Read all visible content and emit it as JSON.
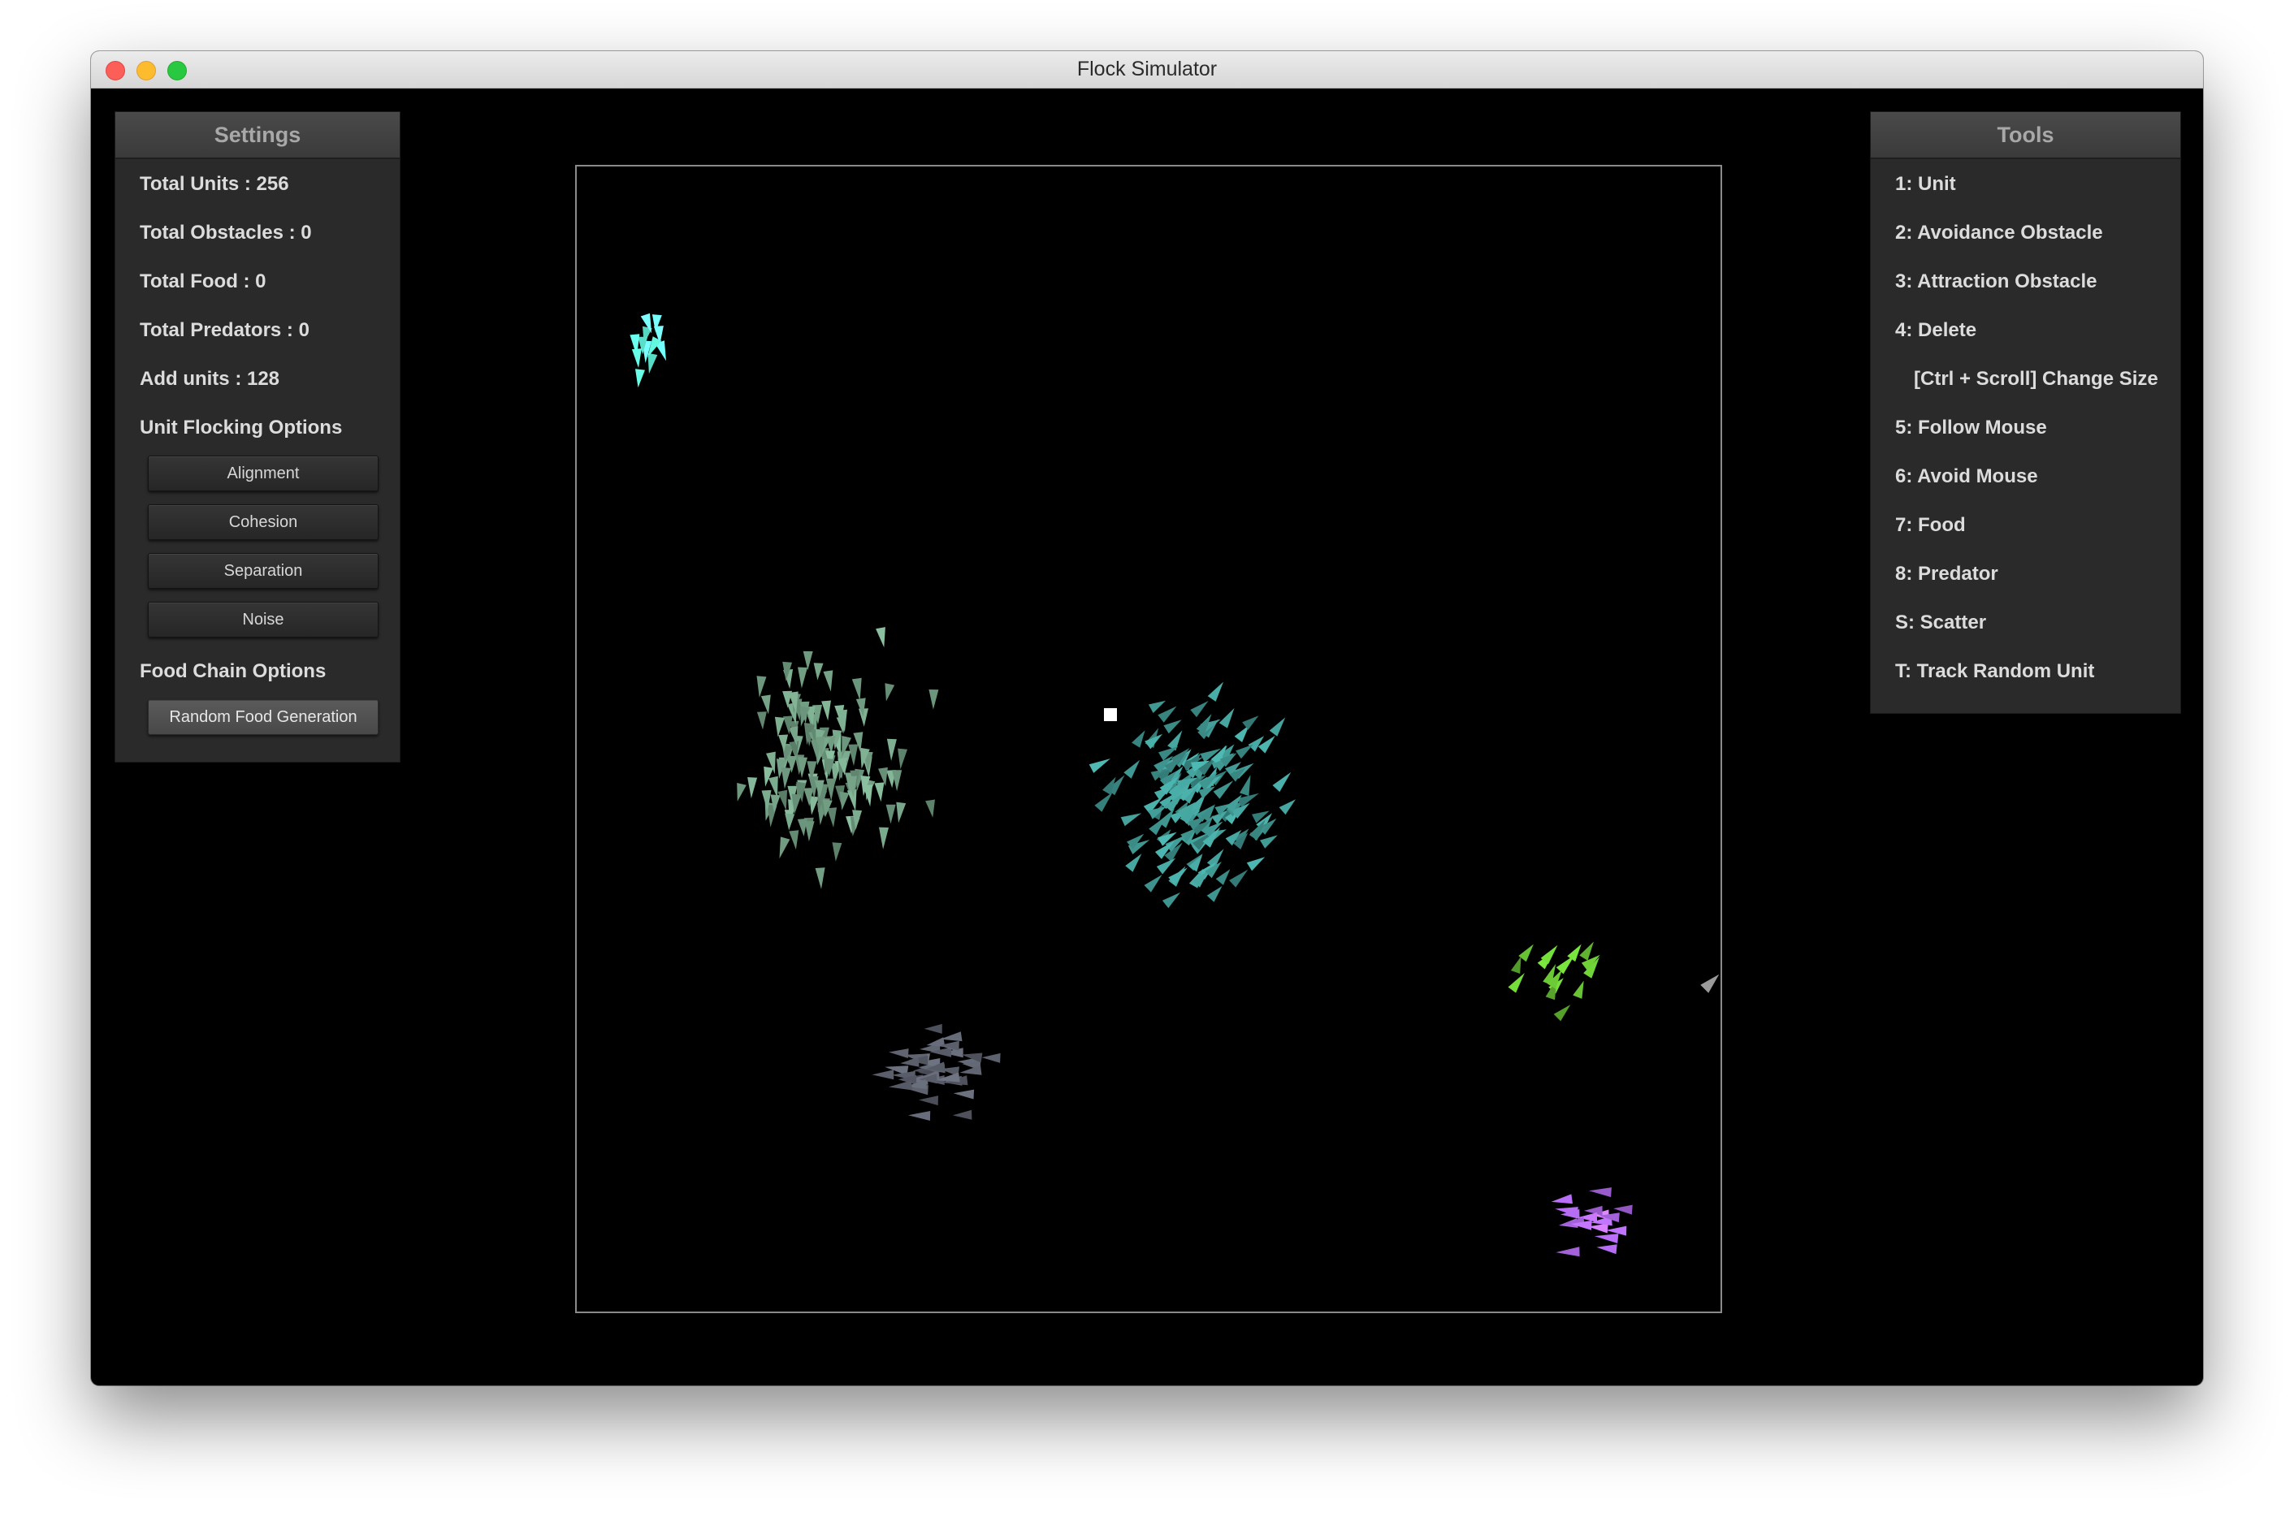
{
  "window": {
    "title": "Flock Simulator"
  },
  "settings": {
    "header": "Settings",
    "total_units": "Total Units : 256",
    "total_obstacles": "Total Obstacles : 0",
    "total_food": "Total Food : 0",
    "total_predators": "Total Predators : 0",
    "add_units": "Add units : 128",
    "flocking_label": "Unit Flocking Options",
    "flocking_buttons": [
      "Alignment",
      "Cohesion",
      "Separation",
      "Noise"
    ],
    "food_chain_label": "Food Chain Options",
    "food_button": "Random Food Generation"
  },
  "tools": {
    "header": "Tools",
    "items": [
      "1: Unit",
      "2: Avoidance Obstacle",
      "3: Attraction Obstacle",
      "4: Delete",
      "[Ctrl + Scroll] Change Size",
      "5: Follow Mouse",
      "6: Avoid Mouse",
      "7: Food",
      "8: Predator",
      "S: Scatter",
      "T: Track Random Unit"
    ]
  },
  "simulation": {
    "flock_colors": {
      "cyan_flock": "#66ffe6",
      "sage_flock": "#6f9a80",
      "teal_flock": "#3f9590",
      "green_flock": "#66c033",
      "slate_flock": "#5a5e6a",
      "purple_flock": "#b46cf0",
      "stray_unit": "#9a9a9a",
      "mouse_cursor": "#ffffff"
    }
  }
}
